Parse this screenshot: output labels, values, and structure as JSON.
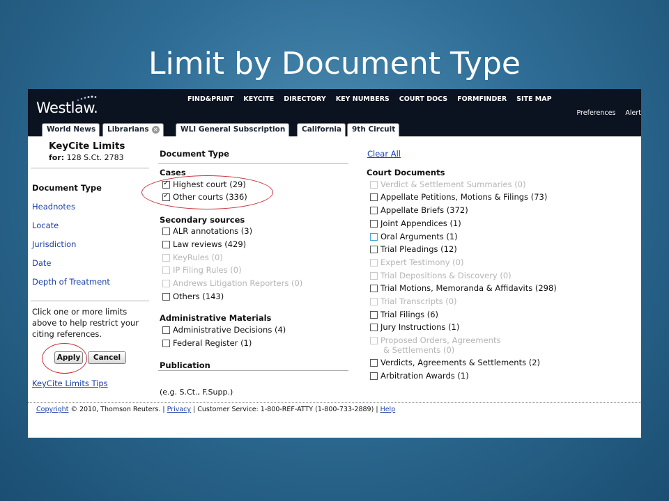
{
  "slide": {
    "title": "Limit by Document Type"
  },
  "header": {
    "logo": "Westlaw.",
    "nav": [
      "FIND&PRINT",
      "KEYCITE",
      "DIRECTORY",
      "KEY NUMBERS",
      "COURT DOCS",
      "FORMFINDER",
      "SITE MAP"
    ],
    "utility": [
      "Preferences",
      "Alert"
    ]
  },
  "tabs": [
    {
      "label": "World News"
    },
    {
      "label": "Librarians"
    },
    {
      "label": "WLI General Subscription"
    },
    {
      "label": "California"
    },
    {
      "label": "9th Circuit"
    }
  ],
  "left_pane": {
    "title": "KeyCite Limits",
    "for_label": "for:",
    "for_value": "128 S.Ct. 2783",
    "nav": [
      "Document Type",
      "Headnotes",
      "Locate",
      "Jurisdiction",
      "Date",
      "Depth of Treatment"
    ],
    "help_text": "Click one or more limits above to help restrict your citing references.",
    "apply_label": "Apply",
    "cancel_label": "Cancel",
    "tips_link": "KeyCite Limits Tips"
  },
  "middle": {
    "heading": "Document Type",
    "cases_heading": "Cases",
    "cases": [
      {
        "label": "Highest court (29)",
        "checked": true,
        "disabled": false
      },
      {
        "label": "Other courts (336)",
        "checked": true,
        "disabled": false
      }
    ],
    "secondary_heading": "Secondary sources",
    "secondary": [
      {
        "label": "ALR annotations (3)",
        "checked": false,
        "disabled": false
      },
      {
        "label": "Law reviews (429)",
        "checked": false,
        "disabled": false
      },
      {
        "label": "KeyRules (0)",
        "checked": false,
        "disabled": true
      },
      {
        "label": "IP Filing Rules (0)",
        "checked": false,
        "disabled": true
      },
      {
        "label": "Andrews Litigation Reporters (0)",
        "checked": false,
        "disabled": true
      },
      {
        "label": "Others (143)",
        "checked": false,
        "disabled": false
      }
    ],
    "admin_heading": "Administrative Materials",
    "admin": [
      {
        "label": "Administrative Decisions (4)",
        "checked": false,
        "disabled": false
      },
      {
        "label": "Federal Register (1)",
        "checked": false,
        "disabled": false
      }
    ],
    "publication_heading": "Publication",
    "publication_hint": "(e.g. S.Ct., F.Supp.)"
  },
  "right": {
    "clear_all": "Clear All",
    "court_docs_heading": "Court Documents",
    "items": [
      {
        "label": "Verdict & Settlement Summaries (0)",
        "disabled": true
      },
      {
        "label": "Appellate Petitions, Motions & Filings (73)",
        "disabled": false
      },
      {
        "label": "Appellate Briefs (372)",
        "disabled": false
      },
      {
        "label": "Joint Appendices (1)",
        "disabled": false
      },
      {
        "label": "Oral Arguments (1)",
        "disabled": false
      },
      {
        "label": "Trial Pleadings (12)",
        "disabled": false
      },
      {
        "label": "Expert Testimony (0)",
        "disabled": true
      },
      {
        "label": "Trial Depositions & Discovery (0)",
        "disabled": true
      },
      {
        "label": "Trial Motions, Memoranda & Affidavits (298)",
        "disabled": false
      },
      {
        "label": "Trial Transcripts (0)",
        "disabled": true
      },
      {
        "label": "Trial Filings (6)",
        "disabled": false
      },
      {
        "label": "Jury Instructions (1)",
        "disabled": false
      },
      {
        "label": "Proposed Orders, Agreements",
        "label2": "& Settlements (0)",
        "disabled": true
      },
      {
        "label": "Verdicts, Agreements & Settlements (2)",
        "disabled": false
      },
      {
        "label": "Arbitration Awards (1)",
        "disabled": false
      }
    ]
  },
  "footer": {
    "copyright_link": "Copyright",
    "copyright_text": "© 2010, Thomson Reuters.",
    "privacy_link": "Privacy",
    "service_text": "Customer Service: 1-800-REF-ATTY (1-800-733-2889)",
    "help_link": "Help"
  },
  "colors": {
    "header_bg": "#0c1320",
    "link": "#1b3fa8",
    "annotation": "#c9303a"
  }
}
